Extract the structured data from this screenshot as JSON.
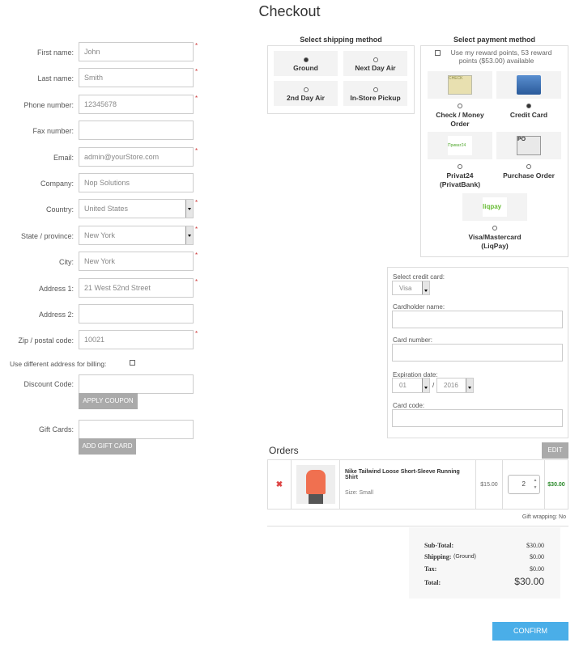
{
  "title": "Checkout",
  "form": {
    "fields": [
      {
        "label": "First name:",
        "value": "John",
        "required": true
      },
      {
        "label": "Last name:",
        "value": "Smith",
        "required": true
      },
      {
        "label": "Phone number:",
        "value": "12345678",
        "required": true
      },
      {
        "label": "Fax number:",
        "value": "",
        "required": false
      },
      {
        "label": "Email:",
        "value": "admin@yourStore.com",
        "required": true
      },
      {
        "label": "Company:",
        "value": "Nop Solutions",
        "required": false
      },
      {
        "label": "Country:",
        "value": "United States",
        "required": true,
        "select": true
      },
      {
        "label": "State / province:",
        "value": "New York",
        "required": true,
        "select": true
      },
      {
        "label": "City:",
        "value": "New York",
        "required": true
      },
      {
        "label": "Address 1:",
        "value": "21 West 52nd Street",
        "required": true
      },
      {
        "label": "Address 2:",
        "value": "",
        "required": false
      },
      {
        "label": "Zip / postal code:",
        "value": "10021",
        "required": true
      }
    ],
    "billing_label": "Use different address for billing:",
    "discount_label": "Discount Code:",
    "apply_coupon": "APPLY COUPON",
    "gift_label": "Gift Cards:",
    "add_gift": "ADD GIFT CARD"
  },
  "shipping": {
    "title": "Select shipping method",
    "options": [
      {
        "label": "Ground",
        "selected": true
      },
      {
        "label": "Next Day Air",
        "selected": false
      },
      {
        "label": "2nd Day Air",
        "selected": false
      },
      {
        "label": "In-Store Pickup",
        "selected": false
      }
    ]
  },
  "payment": {
    "title": "Select payment method",
    "reward": "Use my reward points, 53 reward points ($53.00) available",
    "methods": [
      {
        "label": "Check / Money Order",
        "selected": false,
        "icon": "check-icon",
        "logo": "CHECK"
      },
      {
        "label": "Credit Card",
        "selected": true,
        "icon": "credit-card-icon",
        "logo": ""
      },
      {
        "label": "Privat24 (PrivatBank)",
        "selected": false,
        "icon": "privat24-logo",
        "logo": "Приват24"
      },
      {
        "label": "Purchase Order",
        "selected": false,
        "icon": "purchase-order-icon",
        "logo": "PO"
      },
      {
        "label": "Visa/Mastercard (LiqPay)",
        "selected": false,
        "icon": "liqpay-logo",
        "logo": "liqpay"
      }
    ]
  },
  "card": {
    "select_label": "Select credit card:",
    "card_type": "Visa",
    "holder_label": "Cardholder name:",
    "number_label": "Card number:",
    "exp_label": "Expiration date:",
    "exp_month": "01",
    "exp_sep": "/",
    "exp_year": "2016",
    "code_label": "Card code:"
  },
  "orders": {
    "title": "Orders",
    "edit": "EDIT",
    "item": {
      "name": "Nike Tailwind Loose Short-Sleeve Running Shirt",
      "attr": "Size: Small",
      "price": "$15.00",
      "qty": "2",
      "total": "$30.00"
    },
    "gift_wrapping": "Gift wrapping: No",
    "totals": {
      "sub_label": "Sub-Total:",
      "sub": "$30.00",
      "ship_label": "Shipping:",
      "ship_method": "(Ground)",
      "ship": "$0.00",
      "tax_label": "Tax:",
      "tax": "$0.00",
      "total_label": "Total:",
      "total": "$30.00"
    },
    "confirm": "CONFIRM"
  },
  "colors": {
    "accent": "#4aaee8",
    "total_green": "#2a8a2a",
    "required": "#cc3333"
  }
}
